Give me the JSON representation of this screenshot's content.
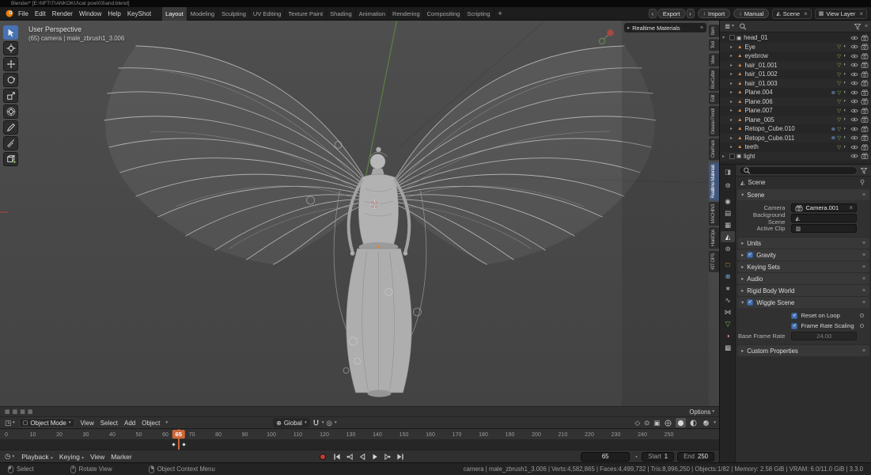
{
  "window": {
    "title": "Blender*  [E:\\NFT\\TIANKOKU\\cat pow\\03\\and.blend]"
  },
  "topbar": {
    "menus": [
      "File",
      "Edit",
      "Render",
      "Window",
      "Help",
      "KeyShot"
    ],
    "workspaces": [
      {
        "label": "Layout",
        "active": true
      },
      {
        "label": "Modeling"
      },
      {
        "label": "Sculpting"
      },
      {
        "label": "UV Editing"
      },
      {
        "label": "Texture Paint"
      },
      {
        "label": "Shading"
      },
      {
        "label": "Animation"
      },
      {
        "label": "Rendering"
      },
      {
        "label": "Compositing"
      },
      {
        "label": "Scripting"
      }
    ],
    "add_tab": "+",
    "export_label": "Export",
    "import_label": "Import",
    "manual_label": "Manual",
    "scene_name": "Scene",
    "view_layer_name": "View Layer"
  },
  "toolbar": {
    "tools": [
      {
        "name": "select-box",
        "active": true
      },
      {
        "name": "cursor"
      },
      {
        "name": "move"
      },
      {
        "name": "rotate"
      },
      {
        "name": "scale"
      },
      {
        "name": "transform"
      },
      {
        "name": "annotate"
      },
      {
        "name": "measure"
      },
      {
        "name": "add-cube"
      }
    ]
  },
  "viewport": {
    "perspective_label": "User Perspective",
    "context_label": "(65) camera | male_zbrush1_3.006",
    "floating_panel_label": "Realtime Materials",
    "header": {
      "mode": "Object Mode",
      "menus": [
        "View",
        "Select",
        "Add",
        "Object"
      ],
      "orientation": "Global",
      "options_label": "Options"
    }
  },
  "sidebar_tabs": [
    {
      "label": "Item"
    },
    {
      "label": "Tool"
    },
    {
      "label": "View"
    },
    {
      "label": "BoxCutter"
    },
    {
      "label": "Edit"
    },
    {
      "label": "Grease Pencil"
    },
    {
      "label": "CinePack"
    },
    {
      "label": "Realtime Materials",
      "active": true
    },
    {
      "label": "MACHIN3"
    },
    {
      "label": "HardOps"
    },
    {
      "label": "KIT OPS"
    }
  ],
  "outliner": {
    "items": [
      {
        "label": "head_01",
        "kind": "collection",
        "expanded": true
      },
      {
        "label": "Eye",
        "kind": "object"
      },
      {
        "label": "eyebrow",
        "kind": "object"
      },
      {
        "label": "hair_01.001",
        "kind": "object"
      },
      {
        "label": "hair_01.002",
        "kind": "object"
      },
      {
        "label": "hair_01.003",
        "kind": "object"
      },
      {
        "label": "Plane.004",
        "kind": "object",
        "modifier": true
      },
      {
        "label": "Plane.006",
        "kind": "object"
      },
      {
        "label": "Plane.007",
        "kind": "object"
      },
      {
        "label": "Plane_005",
        "kind": "object"
      },
      {
        "label": "Retopo_Cube.010",
        "kind": "object",
        "modifier": true
      },
      {
        "label": "Retopo_Cube.011",
        "kind": "object",
        "modifier": true
      },
      {
        "label": "teeth",
        "kind": "object"
      },
      {
        "label": "light",
        "kind": "collection",
        "expanded": false
      }
    ]
  },
  "properties": {
    "breadcrumb": "Scene",
    "tabs": [
      {
        "name": "tool"
      },
      {
        "name": "render"
      },
      {
        "name": "output"
      },
      {
        "name": "view-layer"
      },
      {
        "name": "scene",
        "active": true
      },
      {
        "name": "world"
      },
      {
        "name": "object"
      },
      {
        "name": "modifiers"
      },
      {
        "name": "particles"
      },
      {
        "name": "physics"
      },
      {
        "name": "constraints"
      },
      {
        "name": "object-data"
      },
      {
        "name": "material"
      },
      {
        "name": "texture"
      }
    ],
    "scene_panel": {
      "title": "Scene",
      "rows": [
        {
          "label": "Camera",
          "value": "Camera.001",
          "icon": "camera",
          "clearable": true
        },
        {
          "label": "Background Scene",
          "value": "",
          "icon": "scene"
        },
        {
          "label": "Active Clip",
          "value": "",
          "icon": "clip"
        }
      ]
    },
    "collapsed_panels": [
      {
        "label": "Units"
      },
      {
        "label": "Gravity",
        "checkbox": true,
        "checked": true
      },
      {
        "label": "Keying Sets"
      },
      {
        "label": "Audio"
      },
      {
        "label": "Rigid Body World"
      }
    ],
    "wiggle_panel": {
      "title": "Wiggle Scene",
      "enabled": true,
      "reset_label": "Reset on Loop",
      "reset_checked": true,
      "frs_label": "Frame Rate Scaling",
      "frs_checked": true,
      "base_label": "Base Frame Rate",
      "base_value": "24.00"
    },
    "custom_panel": {
      "label": "Custom Properties"
    }
  },
  "timeline": {
    "ticks": [
      "0",
      "10",
      "20",
      "30",
      "40",
      "50",
      "60",
      "70",
      "80",
      "90",
      "100",
      "110",
      "120",
      "130",
      "140",
      "150",
      "160",
      "170",
      "180",
      "190",
      "200",
      "210",
      "220",
      "230",
      "240",
      "250"
    ],
    "current": 65,
    "current_label": "65"
  },
  "playbar": {
    "menus": [
      {
        "label": "Playback",
        "caret": true
      },
      {
        "label": "Keying",
        "caret": true
      },
      {
        "label": "View"
      },
      {
        "label": "Marker"
      }
    ],
    "frame": "65",
    "start_label": "Start",
    "start_value": "1",
    "end_label": "End",
    "end_value": "250"
  },
  "statusbar": {
    "hints": [
      {
        "label": "Select",
        "button": "left"
      },
      {
        "label": "Rotate View",
        "button": "middle"
      },
      {
        "label": "Object Context Menu",
        "button": "right"
      }
    ],
    "stats": "camera | male_zbrush1_3.006 | Verts:4,582,865 | Faces:4,499,732 | Tris:8,996,250 | Objects:1/82 | Memory: 2.58 GiB | VRAM: 6.0/11.0 GiB | 3.3.0"
  },
  "colors": {
    "accent": "#4772b3",
    "frame_marker": "#cd6839",
    "axis_green": "#67a144",
    "object_orange": "#e08b42"
  }
}
